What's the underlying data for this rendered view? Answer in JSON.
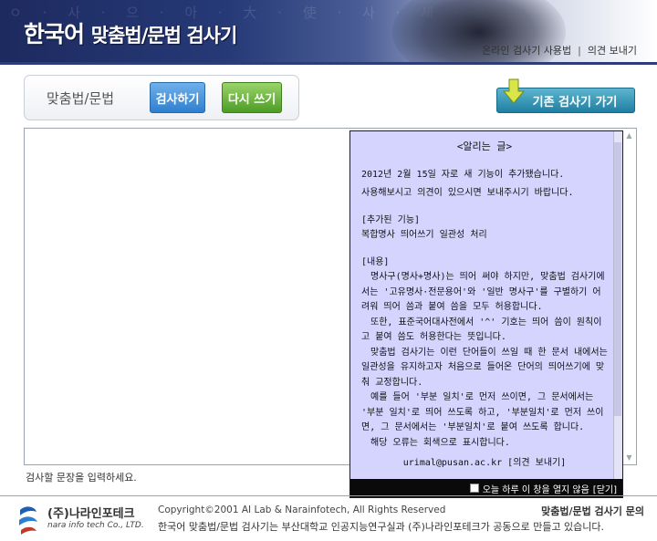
{
  "header": {
    "title_main": "한국어",
    "title_sub": "맞춤법/문법 검사기",
    "background_glyphs": "ㅇ · 사 · 으 · 아 · 大 · 使 · 사 · 세 · 文 · 시 · 비 · 丁 · 라 · 니 · 사 · 이 · 火 · 세",
    "links": [
      "온라인 검사기 사용법",
      "의견 보내기"
    ],
    "link_separator": "|"
  },
  "toolbar": {
    "label": "맞춤법/문법",
    "check_button": "검사하기",
    "reset_button": "다시 쓰기"
  },
  "legacy_button": "기존 검사기 가기",
  "editor": {
    "value": "",
    "hint": "검사할 문장을 입력하세요."
  },
  "notice": {
    "title": "<알리는 글>",
    "line1": "2012년 2월 15일 자로 새 기능이 추가됐습니다.",
    "line2": "사용해보시고 의견이 있으시면 보내주시기 바랍니다.",
    "added_heading": "[추가된 기능]",
    "added_item": "복합명사 띄어쓰기 일관성 처리",
    "content_heading": "[내용]",
    "paragraph1": "명사구(명사+명사)는 띄어 써야 하지만, 맞춤법 검사기에서는 '고유명사·전문용어'와 '일반 명사구'를 구별하기 어려워 띄어 씀과 붙여 씀을 모두 허용합니다.",
    "paragraph2": "또한, 표준국어대사전에서 '^' 기호는 띄어 씀이 원칙이고 붙여 씀도 허용한다는 뜻입니다.",
    "paragraph3": "맞춤법 검사기는 이런 단어들이 쓰일 때 한 문서 내에서는 일관성을 유지하고자 처음으로 들어온 단어의 띄어쓰기에 맞춰 교정합니다.",
    "paragraph4": "예를 들어 '부분 일치'로 먼저 쓰이면, 그 문서에서는 '부분 일치'로 띄어 쓰도록 하고, '부분일치'로 먼저 쓰이면, 그 문서에서는 '부분일치'로 붙여 쓰도록 합니다.",
    "paragraph5": "해당 오류는 회색으로 표시합니다.",
    "email": "urimal@pusan.ac.kr",
    "feedback_link": "[의견 보내기]",
    "dont_show_today": "오늘 하루 이 창을 열지 않음",
    "close": "[닫기]"
  },
  "footer": {
    "logo_ko": "(주)나라인포테크",
    "logo_en": "nara info tech Co., LTD.",
    "copyright": "Copyright©2001 AI Lab & Narainfotech,  All Rights Reserved",
    "description": "한국어 맞춤법/문법 검사기는 부산대학교 인공지능연구실과 (주)나라인포테크가 공동으로 만들고 있습니다.",
    "inquiry": "맞춤법/문법 검사기 문의"
  }
}
